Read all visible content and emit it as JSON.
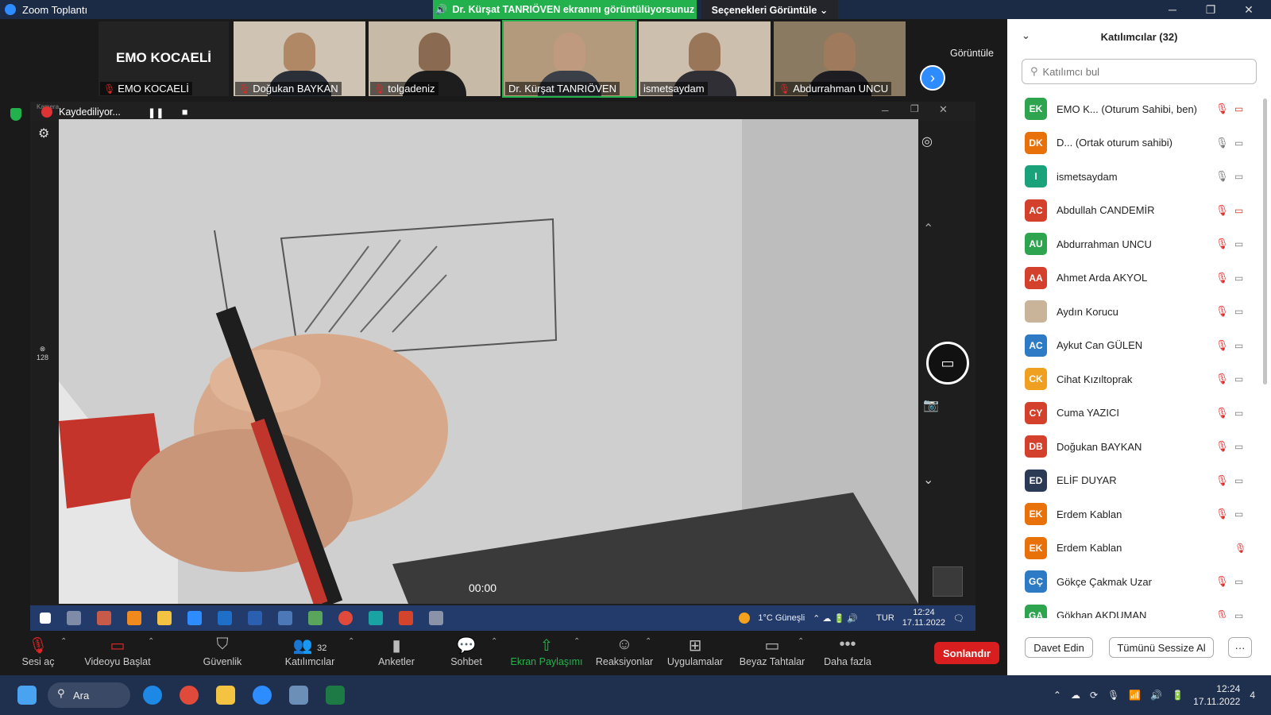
{
  "window": {
    "title": "Zoom Toplantı",
    "share_banner": "Dr. Kürşat TANRIÖVEN ekranını görüntülüyorsunuz",
    "view_options": "Seçenekleri Görüntüle ⌄"
  },
  "gallery": {
    "view_label": "Görüntüle",
    "tiles": [
      {
        "name": "EMO KOCAELİ",
        "muted": true
      },
      {
        "name": "Doğukan BAYKAN",
        "muted": true
      },
      {
        "name": "tolgadeniz",
        "muted": true
      },
      {
        "name": "Dr. Kürşat TANRIÖVEN",
        "muted": false
      },
      {
        "name": "ismetsaydam",
        "muted": false
      },
      {
        "name": "Abdurrahman UNCU",
        "muted": true
      }
    ],
    "host_label": "EMO KOCAELİ"
  },
  "shared_screen": {
    "camera_label": "Kamera",
    "recording": "Kaydediliyor...",
    "timer": "00:00",
    "side_counter": "128",
    "inner_tray": {
      "weather": "1°C Güneşli",
      "lang": "TUR",
      "time": "12:24",
      "date": "17.11.2022"
    }
  },
  "toolbar": {
    "mute": "Sesi aç",
    "video": "Videoyu Başlat",
    "security": "Güvenlik",
    "participants": "Katılımcılar",
    "participants_count": "32",
    "polls": "Anketler",
    "chat": "Sohbet",
    "share": "Ekran Paylaşımı",
    "reactions": "Reaksiyonlar",
    "apps": "Uygulamalar",
    "whiteboards": "Beyaz Tahtalar",
    "more": "Daha fazla",
    "end": "Sonlandır"
  },
  "panel": {
    "title": "Katılımcılar (32)",
    "search_placeholder": "Katılımcı bul",
    "participants": [
      {
        "initials": "EK",
        "name": "EMO K...  (Oturum Sahibi, ben)",
        "color": "#2ea44f",
        "mic": "muted",
        "cam": "off"
      },
      {
        "initials": "DK",
        "name": "D...  (Ortak oturum sahibi)",
        "color": "#e8710a",
        "mic": "on",
        "cam": "on"
      },
      {
        "initials": "I",
        "name": "ismetsaydam",
        "color": "#1aa37a",
        "mic": "on",
        "cam": "on"
      },
      {
        "initials": "AC",
        "name": "Abdullah CANDEMİR",
        "color": "#d3402b",
        "mic": "muted",
        "cam": "off"
      },
      {
        "initials": "AU",
        "name": "Abdurrahman UNCU",
        "color": "#2ea44f",
        "mic": "muted",
        "cam": "on"
      },
      {
        "initials": "AA",
        "name": "Ahmet Arda AKYOL",
        "color": "#d3402b",
        "mic": "muted",
        "cam": "on"
      },
      {
        "initials": "",
        "name": "Aydın Korucu",
        "color": "#c9b49a",
        "mic": "muted",
        "cam": "on"
      },
      {
        "initials": "AC",
        "name": "Aykut Can GÜLEN",
        "color": "#2d7bc4",
        "mic": "muted",
        "cam": "on"
      },
      {
        "initials": "CK",
        "name": "Cihat Kızıltoprak",
        "color": "#f0a020",
        "mic": "muted",
        "cam": "on"
      },
      {
        "initials": "CY",
        "name": "Cuma YAZICI",
        "color": "#d3402b",
        "mic": "muted",
        "cam": "on"
      },
      {
        "initials": "DB",
        "name": "Doğukan BAYKAN",
        "color": "#d3402b",
        "mic": "muted",
        "cam": "on"
      },
      {
        "initials": "ED",
        "name": "ELİF DUYAR",
        "color": "#2b3a55",
        "mic": "muted",
        "cam": "on"
      },
      {
        "initials": "EK",
        "name": "Erdem Kablan",
        "color": "#e8710a",
        "mic": "muted",
        "cam": "on"
      },
      {
        "initials": "EK",
        "name": "Erdem Kablan",
        "color": "#e8710a",
        "mic": "none",
        "cam": "muted"
      },
      {
        "initials": "GÇ",
        "name": "Gökçe Çakmak Uzar",
        "color": "#2d7bc4",
        "mic": "muted",
        "cam": "on"
      },
      {
        "initials": "GA",
        "name": "Gökhan AKDUMAN",
        "color": "#2ea44f",
        "mic": "muted",
        "cam": "on"
      }
    ],
    "invite": "Davet Edin",
    "mute_all": "Tümünü Sessize Al",
    "more": "···"
  },
  "taskbar": {
    "search": "Ara",
    "time": "12:24",
    "date": "17.11.2022",
    "notifications": "4"
  }
}
